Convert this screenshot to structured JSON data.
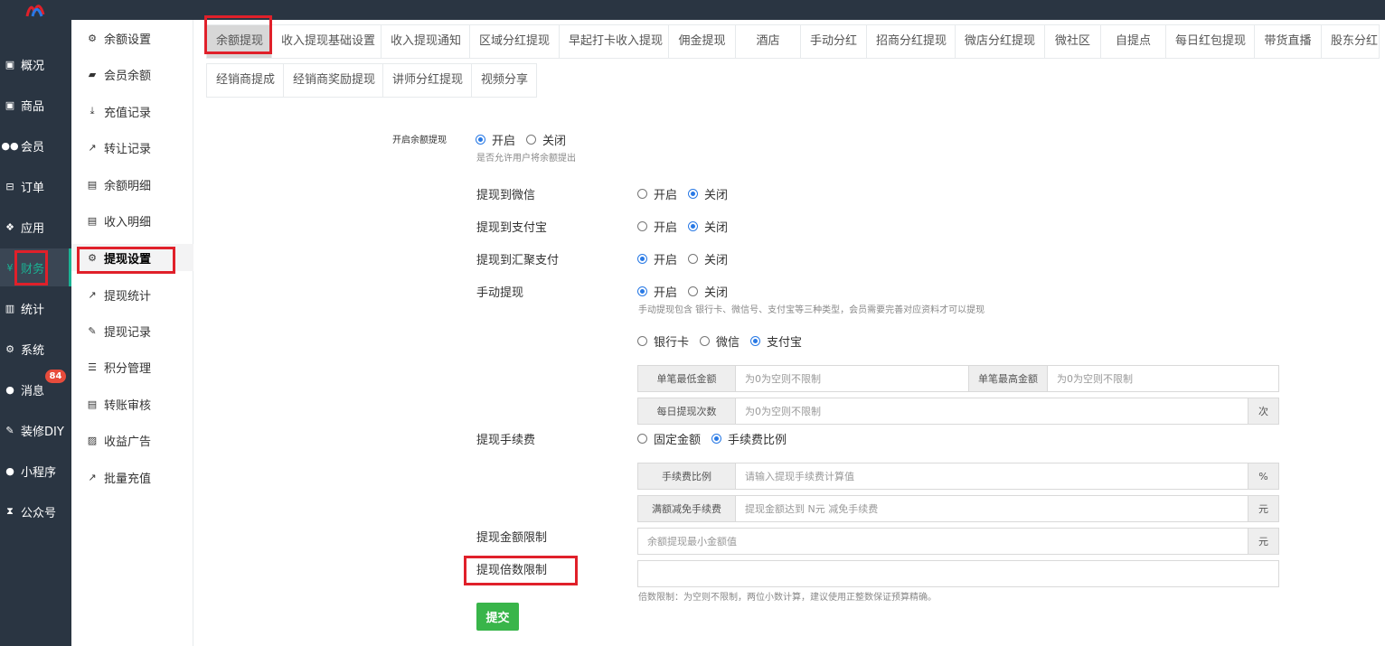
{
  "sidebar": {
    "items": [
      {
        "label": "概况",
        "icon": "square-icon"
      },
      {
        "label": "商品",
        "icon": "box-icon"
      },
      {
        "label": "会员",
        "icon": "users-icon"
      },
      {
        "label": "订单",
        "icon": "cart-icon"
      },
      {
        "label": "应用",
        "icon": "cubes-icon"
      },
      {
        "label": "财务",
        "icon": "yen-icon",
        "active": true
      },
      {
        "label": "统计",
        "icon": "bar-chart-icon"
      },
      {
        "label": "系统",
        "icon": "cogs-icon"
      },
      {
        "label": "消息",
        "icon": "comment-icon",
        "badge": "84"
      },
      {
        "label": "装修DIY",
        "icon": "paint-icon"
      },
      {
        "label": "小程序",
        "icon": "wechat-icon"
      },
      {
        "label": "公众号",
        "icon": "hourglass-icon"
      }
    ]
  },
  "subsidebar": {
    "items": [
      {
        "label": "余额设置",
        "icon": "gear-icon"
      },
      {
        "label": "会员余额",
        "icon": "book-icon"
      },
      {
        "label": "充值记录",
        "icon": "download-icon"
      },
      {
        "label": "转让记录",
        "icon": "external-link-icon"
      },
      {
        "label": "余额明细",
        "icon": "file-icon"
      },
      {
        "label": "收入明细",
        "icon": "file-icon"
      },
      {
        "label": "提现设置",
        "icon": "gear-icon",
        "active": true
      },
      {
        "label": "提现统计",
        "icon": "line-chart-icon"
      },
      {
        "label": "提现记录",
        "icon": "pencil-icon"
      },
      {
        "label": "积分管理",
        "icon": "database-icon"
      },
      {
        "label": "转账审核",
        "icon": "file-icon"
      },
      {
        "label": "收益广告",
        "icon": "image-icon"
      },
      {
        "label": "批量充值",
        "icon": "line-chart-icon"
      }
    ]
  },
  "tabs": {
    "row1": [
      "余额提现",
      "收入提现基础设置",
      "收入提现通知",
      "区域分红提现",
      "早起打卡收入提现",
      "佣金提现",
      "酒店",
      "手动分红",
      "招商分红提现",
      "微店分红提现",
      "微社区",
      "自提点",
      "每日红包提现",
      "带货直播",
      "股东分红"
    ],
    "row2": [
      "经销商提成",
      "经销商奖励提现",
      "讲师分红提现",
      "视频分享"
    ]
  },
  "form": {
    "enable_balance": {
      "label": "开启余额提现",
      "opt_on": "开启",
      "opt_off": "关闭",
      "help": "是否允许用户将余额提出"
    },
    "to_wechat": {
      "label": "提现到微信",
      "opt_on": "开启",
      "opt_off": "关闭"
    },
    "to_alipay": {
      "label": "提现到支付宝",
      "opt_on": "开启",
      "opt_off": "关闭"
    },
    "to_huiju": {
      "label": "提现到汇聚支付",
      "opt_on": "开启",
      "opt_off": "关闭"
    },
    "manual": {
      "label": "手动提现",
      "opt_on": "开启",
      "opt_off": "关闭",
      "help": "手动提现包含 银行卡、微信号、支付宝等三种类型，会员需要完善对应资料才可以提现"
    },
    "manual_types": {
      "bank": "银行卡",
      "wechat": "微信",
      "alipay": "支付宝"
    },
    "min_amount": {
      "addon": "单笔最低金额",
      "placeholder": "为0为空则不限制"
    },
    "max_amount": {
      "addon": "单笔最高金额",
      "placeholder": "为0为空则不限制"
    },
    "daily_times": {
      "addon": "每日提现次数",
      "placeholder": "为0为空则不限制",
      "unit": "次"
    },
    "fee": {
      "label": "提现手续费",
      "opt_fixed": "固定金额",
      "opt_ratio": "手续费比例"
    },
    "fee_ratio": {
      "addon": "手续费比例",
      "placeholder": "请输入提现手续费计算值",
      "unit": "%"
    },
    "fee_free": {
      "addon": "满额减免手续费",
      "placeholder": "提现金额达到 N元 减免手续费",
      "unit": "元"
    },
    "amount_limit": {
      "label": "提现金额限制",
      "placeholder": "余额提现最小金额值",
      "unit": "元"
    },
    "multiple_limit": {
      "label": "提现倍数限制",
      "value": "",
      "help": "倍数限制：为空则不限制，两位小数计算，建议使用正整数保证预算精确。"
    },
    "submit": "提交"
  },
  "colors": {
    "sidebar_bg": "#2a3542",
    "accent": "#1ab394",
    "highlight": "#e0202a",
    "radio": "#2879e5",
    "submit": "#39b54a"
  }
}
